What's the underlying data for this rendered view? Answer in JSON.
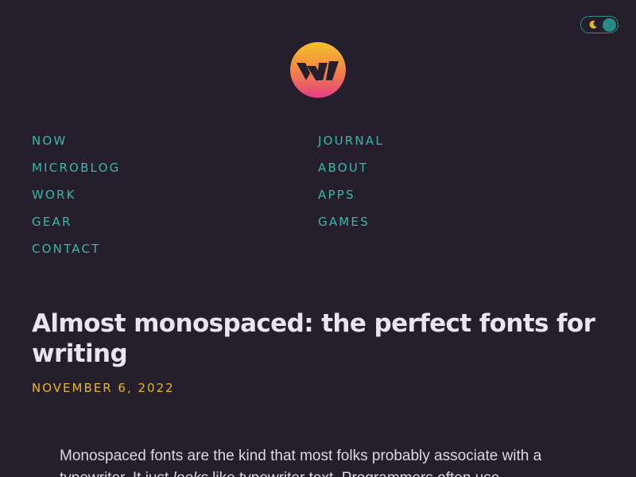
{
  "theme_toggle": {
    "icon": "moon-icon",
    "state": "dark"
  },
  "logo": {
    "name": "site-logo",
    "gradient": [
      "#f6c02b",
      "#e8407d"
    ]
  },
  "nav": {
    "left": [
      {
        "label": "NOW"
      },
      {
        "label": "MICROBLOG"
      },
      {
        "label": "WORK"
      },
      {
        "label": "GEAR"
      },
      {
        "label": "CONTACT"
      }
    ],
    "right": [
      {
        "label": "JOURNAL"
      },
      {
        "label": "ABOUT"
      },
      {
        "label": "APPS"
      },
      {
        "label": "GAMES"
      }
    ]
  },
  "article": {
    "title": "Almost monospaced: the perfect fonts for writing",
    "date": "NOVEMBER 6, 2022",
    "intro_before": "Monospaced fonts are the kind that most folks probably associate with a typewriter. It just ",
    "intro_em": "looks",
    "intro_after": " like typewriter text. Programmers often use"
  },
  "colors": {
    "background": "#251f2d",
    "link": "#3cb6a8",
    "date": "#e5b52a",
    "text": "#e9e5ee"
  }
}
